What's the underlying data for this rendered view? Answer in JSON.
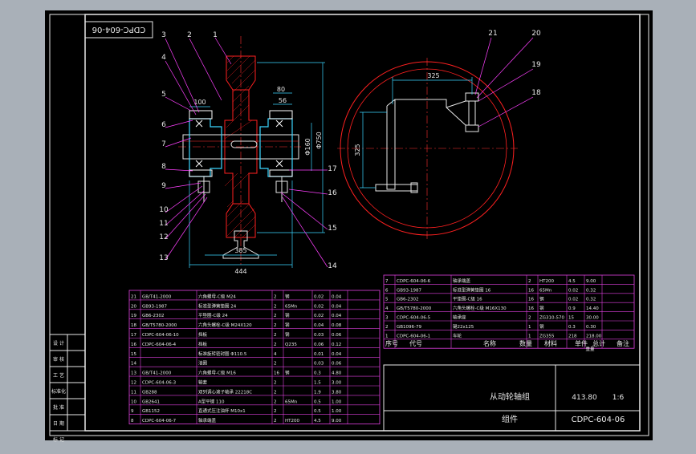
{
  "drawing": {
    "title_block": {
      "rotated_code": "CDPC-604-06",
      "name": "从动轮轴组",
      "mass": "413.80",
      "scale": "1:6",
      "type": "组件",
      "code": "CDPC-604-06"
    },
    "callouts": {
      "front": [
        "1",
        "2",
        "3",
        "4",
        "5",
        "6",
        "7",
        "8",
        "9",
        "10",
        "11",
        "12",
        "13",
        "14",
        "15",
        "16",
        "17"
      ],
      "side": [
        "18",
        "19",
        "20",
        "21"
      ]
    },
    "dimensions": {
      "d100": "100",
      "d80": "80",
      "d56": "56",
      "d160": "Φ160",
      "d750": "Φ750",
      "d385": "385",
      "d444": "444",
      "d325a": "325",
      "d325b": "325"
    },
    "left_sidebar_labels": [
      "设 计",
      "审 核",
      "工 艺",
      "标准化",
      "批 准",
      "日 期",
      "标 记"
    ],
    "bom_headers": {
      "seq": "序号",
      "code": "代号",
      "name": "名称",
      "qty": "数量",
      "material": "材料",
      "unit": "单件",
      "total": "总计",
      "weight": "重量",
      "remark": "备注"
    },
    "bom_right": [
      [
        "7",
        "CDPC-604-06-6",
        "轴承端盖",
        "2",
        "HT200",
        "4.5",
        "9.00",
        ""
      ],
      [
        "6",
        "GB93-1987",
        "标准型弹簧垫圈 16",
        "16",
        "65Mn",
        "0.02",
        "0.32",
        ""
      ],
      [
        "5",
        "GB6-2302",
        "平垫圈-C级 16",
        "16",
        "钢",
        "0.02",
        "0.32",
        ""
      ],
      [
        "4",
        "GB/T5780-2000",
        "六角头螺栓-C级 M16X130",
        "16",
        "钢",
        "0.9",
        "14.40",
        ""
      ],
      [
        "3",
        "CDPC-604-06-5",
        "轴承座",
        "2",
        "ZG310-570",
        "15",
        "30.00",
        ""
      ],
      [
        "2",
        "GB1096-79",
        "键22x125",
        "1",
        "钢",
        "0.3",
        "0.30",
        ""
      ],
      [
        "1",
        "CDPC-604-06-1",
        "车轮",
        "1",
        "ZG355",
        "218",
        "218.00",
        ""
      ]
    ],
    "bom_left": [
      [
        "21",
        "GB/T41-2000",
        "六角螺母-C级 M24",
        "2",
        "钢",
        "0.02",
        "0.04",
        ""
      ],
      [
        "20",
        "GB93-1987",
        "标准型弹簧垫圈 24",
        "2",
        "65Mn",
        "0.02",
        "0.04",
        ""
      ],
      [
        "19",
        "GB6-2302",
        "平垫圈-C级 24",
        "2",
        "钢",
        "0.02",
        "0.04",
        ""
      ],
      [
        "18",
        "GB/T5780-2000",
        "六角头螺栓-C级 M24X120",
        "2",
        "钢",
        "0.04",
        "0.08",
        ""
      ],
      [
        "17",
        "CDPC-604-06-10",
        "挡板",
        "2",
        "钢",
        "0.03",
        "0.06",
        ""
      ],
      [
        "16",
        "CDPC-604-06-4",
        "挡板",
        "2",
        "Q235",
        "0.06",
        "0.12",
        ""
      ],
      [
        "15",
        "",
        "标准旋转密封圈 Φ110.5",
        "4",
        "",
        "0.01",
        "0.04",
        ""
      ],
      [
        "14",
        "",
        "油圈",
        "2",
        "",
        "0.03",
        "0.06",
        ""
      ],
      [
        "13",
        "GB/T41-2000",
        "六角螺母-C级 M16",
        "16",
        "钢",
        "0.3",
        "4.80",
        ""
      ],
      [
        "12",
        "CDPC-604-06-3",
        "轴套",
        "2",
        "",
        "1.5",
        "3.00",
        ""
      ],
      [
        "11",
        "GB288",
        "双列调心滚子轴承 22218C",
        "2",
        "",
        "1.9",
        "3.80",
        ""
      ],
      [
        "10",
        "GB2641",
        "A型平键 110",
        "2",
        "65Mn",
        "0.5",
        "1.00",
        ""
      ],
      [
        "9",
        "GB1152",
        "直通式压注油杯 M10x1",
        "2",
        "",
        "0.5",
        "1.00",
        ""
      ],
      [
        "8",
        "CDPC-604-06-7",
        "轴承端盖",
        "2",
        "HT200",
        "4.5",
        "9.00",
        ""
      ]
    ]
  }
}
